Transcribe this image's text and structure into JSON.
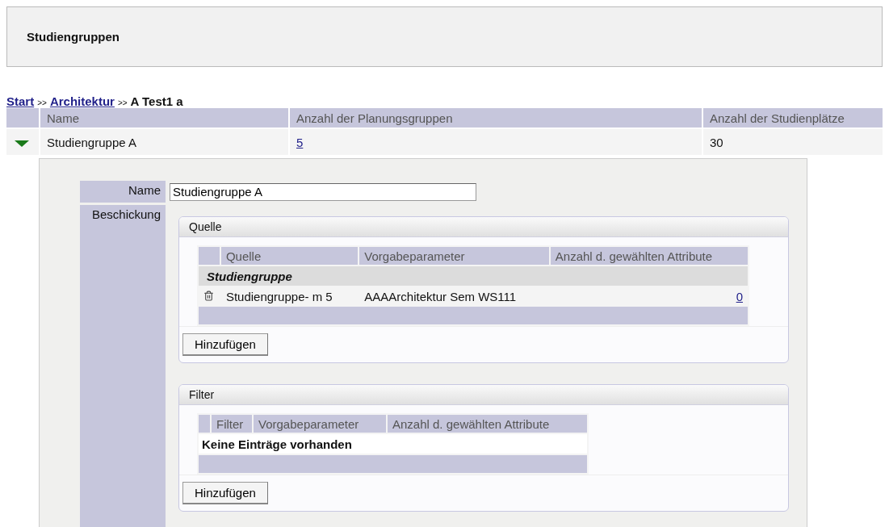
{
  "page_title": "Studiengruppen",
  "breadcrumb": [
    {
      "kind": "link",
      "label": "Start"
    },
    {
      "kind": "separator",
      "label": ">>"
    },
    {
      "kind": "link",
      "label": "Architektur"
    },
    {
      "kind": "separator",
      "label": ">>"
    },
    {
      "kind": "current",
      "label": "A Test1 a"
    }
  ],
  "table": {
    "columns": [
      "Name",
      "Anzahl der Planungsgruppen",
      "Anzahl der Studienplätze"
    ],
    "rows": [
      {
        "expanded": true,
        "name": "Studiengruppe A",
        "planungsgruppen": "5",
        "studienplaetze": "30"
      }
    ]
  },
  "detail": {
    "name_label": "Name",
    "name_value": "Studiengruppe A",
    "beschickung_label": "Beschickung",
    "panels": [
      {
        "title": "Quelle",
        "columns": [
          "Quelle",
          "Vorgabeparameter",
          "Anzahl d. gewählten Attribute"
        ],
        "groups": [
          {
            "label": "Studiengruppe",
            "rows": [
              {
                "cells": [
                  "Studiengruppe- m 5",
                  "AAAArchitektur Sem WS111",
                  "0"
                ]
              }
            ]
          }
        ],
        "button": "Hinzufügen"
      },
      {
        "title": "Filter",
        "columns": [
          "Filter",
          "Vorgabeparameter",
          "Anzahl d. gewählten Attribute"
        ],
        "empty_text": "Keine Einträge vorhanden",
        "button": "Hinzufügen"
      }
    ]
  }
}
